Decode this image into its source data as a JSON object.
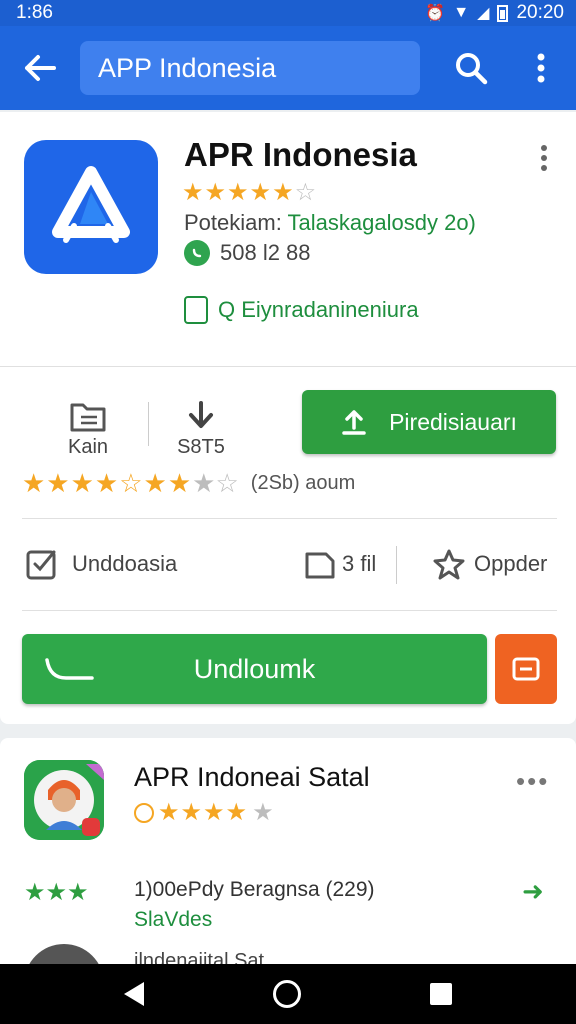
{
  "status_bar": {
    "time_left": "1:86",
    "time_right": "20:20"
  },
  "app_bar": {
    "search_text": "APP Indonesia"
  },
  "app": {
    "title": "APR Indonesia",
    "rating_stars": "★★★★★",
    "rating_empty": "☆",
    "publisher_label": "Potekiam:",
    "publisher_value": "Talaskagalosdy 2o)",
    "whatsapp_count": "508 l2 88",
    "feature_label": "Q  Eiynradanineniura"
  },
  "stats": {
    "item1_label": "Kain",
    "item2_label": "S8T5",
    "primary_button": "Piredisiauarı"
  },
  "rating_summary": {
    "stars_filled": "★★★★",
    "stars_mixed": "☆★★",
    "stars_empty": "★☆",
    "count_text": "(2Sb) aoum"
  },
  "actions": {
    "a1": "Unddoasia",
    "a2": "3 fil",
    "a3": "Oppder"
  },
  "big_button": {
    "label": "Undloumk"
  },
  "card2": {
    "title": "APR Indoneai Satal",
    "stars": "★★★★",
    "star_empty": "★",
    "green_stars": "★★★",
    "review_line": "1)00ePdy Beragnsa (229)",
    "review_sub": "SlaVdes",
    "peek_text": "ilndenaiital Sat"
  },
  "colors": {
    "appbar": "#1f66dd",
    "accent_green": "#2e9e40",
    "accent_orange": "#ef6322",
    "star_gold": "#f5a623"
  },
  "icons": [
    "back-arrow-icon",
    "search-icon",
    "more-vert-icon",
    "app-logo-icon",
    "whatsapp-icon",
    "feature-icon",
    "document-icon",
    "download-icon",
    "upload-icon",
    "checkbox-icon",
    "tablet-icon",
    "star-add-icon",
    "phone-curve-icon",
    "screen-icon",
    "arrow-right-icon"
  ]
}
